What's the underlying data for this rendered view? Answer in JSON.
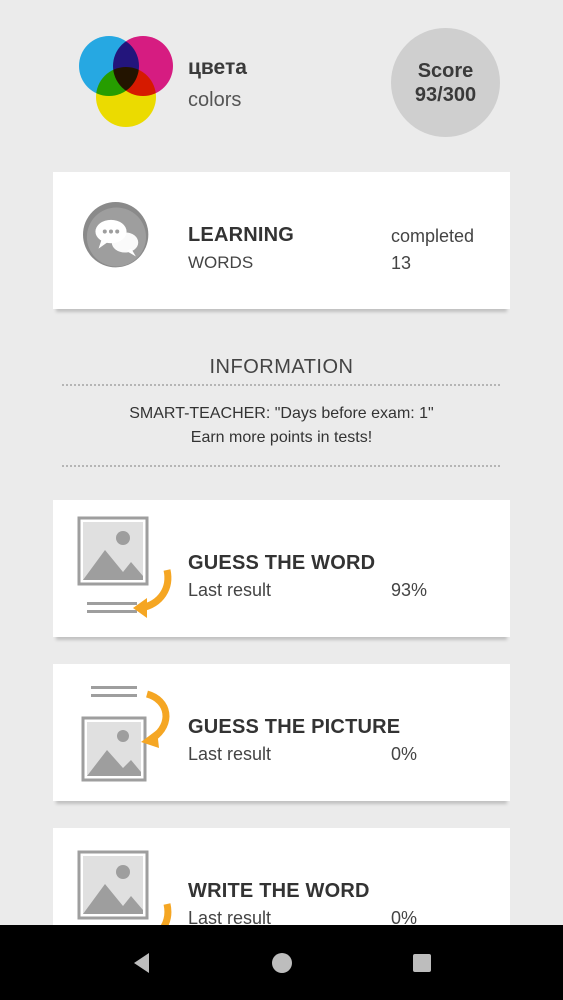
{
  "header": {
    "title_ru": "цвета",
    "title_en": "colors",
    "score_label": "Score",
    "score_value": "93/300"
  },
  "learning": {
    "heading": "LEARNING",
    "sub": "WORDS",
    "status_label": "completed",
    "status_value": "13",
    "icon": "chat-bubbles-icon"
  },
  "info": {
    "title": "INFORMATION",
    "line1": "SMART-TEACHER: \"Days before exam: 1\"",
    "line2": "Earn more points in tests!"
  },
  "tests": [
    {
      "heading": "GUESS THE WORD",
      "result_label": "Last result",
      "result_value": "93%",
      "icon": "picture-to-text-icon"
    },
    {
      "heading": "GUESS THE PICTURE",
      "result_label": "Last result",
      "result_value": "0%",
      "icon": "text-to-picture-icon"
    },
    {
      "heading": "WRITE THE WORD",
      "result_label": "Last result",
      "result_value": "0%",
      "icon": "picture-write-icon"
    }
  ],
  "colors": {
    "background": "#ebebeb",
    "accent_arrow": "#f5a623",
    "icon_gray": "#9e9e9e",
    "score_circle": "#cfcfcf"
  },
  "navbar": {
    "icons": [
      "back-icon",
      "home-icon",
      "recents-icon"
    ]
  }
}
